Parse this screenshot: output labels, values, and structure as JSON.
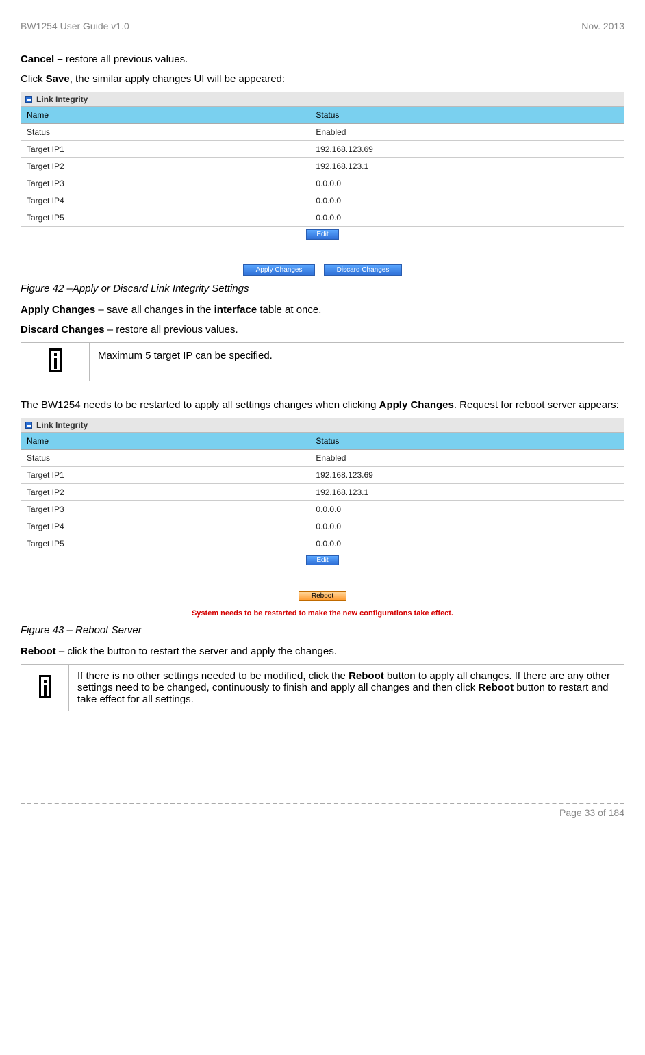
{
  "header": {
    "left": "BW1254 User Guide v1.0",
    "right": "Nov.  2013"
  },
  "intro": {
    "cancel_label": "Cancel –",
    "cancel_desc": " restore all previous values.",
    "click_prefix": "Click ",
    "save_word": "Save",
    "click_suffix": ", the similar apply changes UI will be appeared:"
  },
  "panel": {
    "title": "Link Integrity",
    "columns": {
      "name": "Name",
      "status": "Status"
    },
    "rows": [
      {
        "name": "Status",
        "value": "Enabled"
      },
      {
        "name": "Target IP1",
        "value": "192.168.123.69"
      },
      {
        "name": "Target IP2",
        "value": "192.168.123.1"
      },
      {
        "name": "Target IP3",
        "value": "0.0.0.0"
      },
      {
        "name": "Target IP4",
        "value": "0.0.0.0"
      },
      {
        "name": "Target IP5",
        "value": "0.0.0.0"
      }
    ],
    "edit_label": "Edit",
    "apply_label": "Apply Changes",
    "discard_label": "Discard Changes"
  },
  "fig42": "Figure 42 –Apply or Discard Link Integrity Settings",
  "apply_line": {
    "label": "Apply Changes",
    "mid": " – save all changes in the ",
    "bold_mid": "interface",
    "suffix": " table at once."
  },
  "discard_line": {
    "label": "Discard Changes",
    "suffix": " – restore all previous values."
  },
  "note1": "Maximum 5 target IP can be specified.",
  "restart_text": {
    "prefix": "The BW1254 needs to be restarted to apply all settings changes when clicking ",
    "bold": "Apply Changes",
    "suffix": ". Request for reboot server appears:"
  },
  "reboot_label": "Reboot",
  "warning": "System needs to be restarted to make the new configurations take effect.",
  "fig43": "Figure 43 – Reboot Server",
  "reboot_line": {
    "label": "Reboot",
    "suffix": " – click the button to restart the server and apply the changes."
  },
  "note2": {
    "p1": "If there is no other settings needed to be modified, click the ",
    "b1": "Reboot",
    "p2": " button to apply all changes. If there are any other settings need to be changed, continuously to finish and apply all changes and then click ",
    "b2": "Reboot",
    "p3": " button to restart and take effect  for all settings."
  },
  "footer": "Page 33 of 184"
}
